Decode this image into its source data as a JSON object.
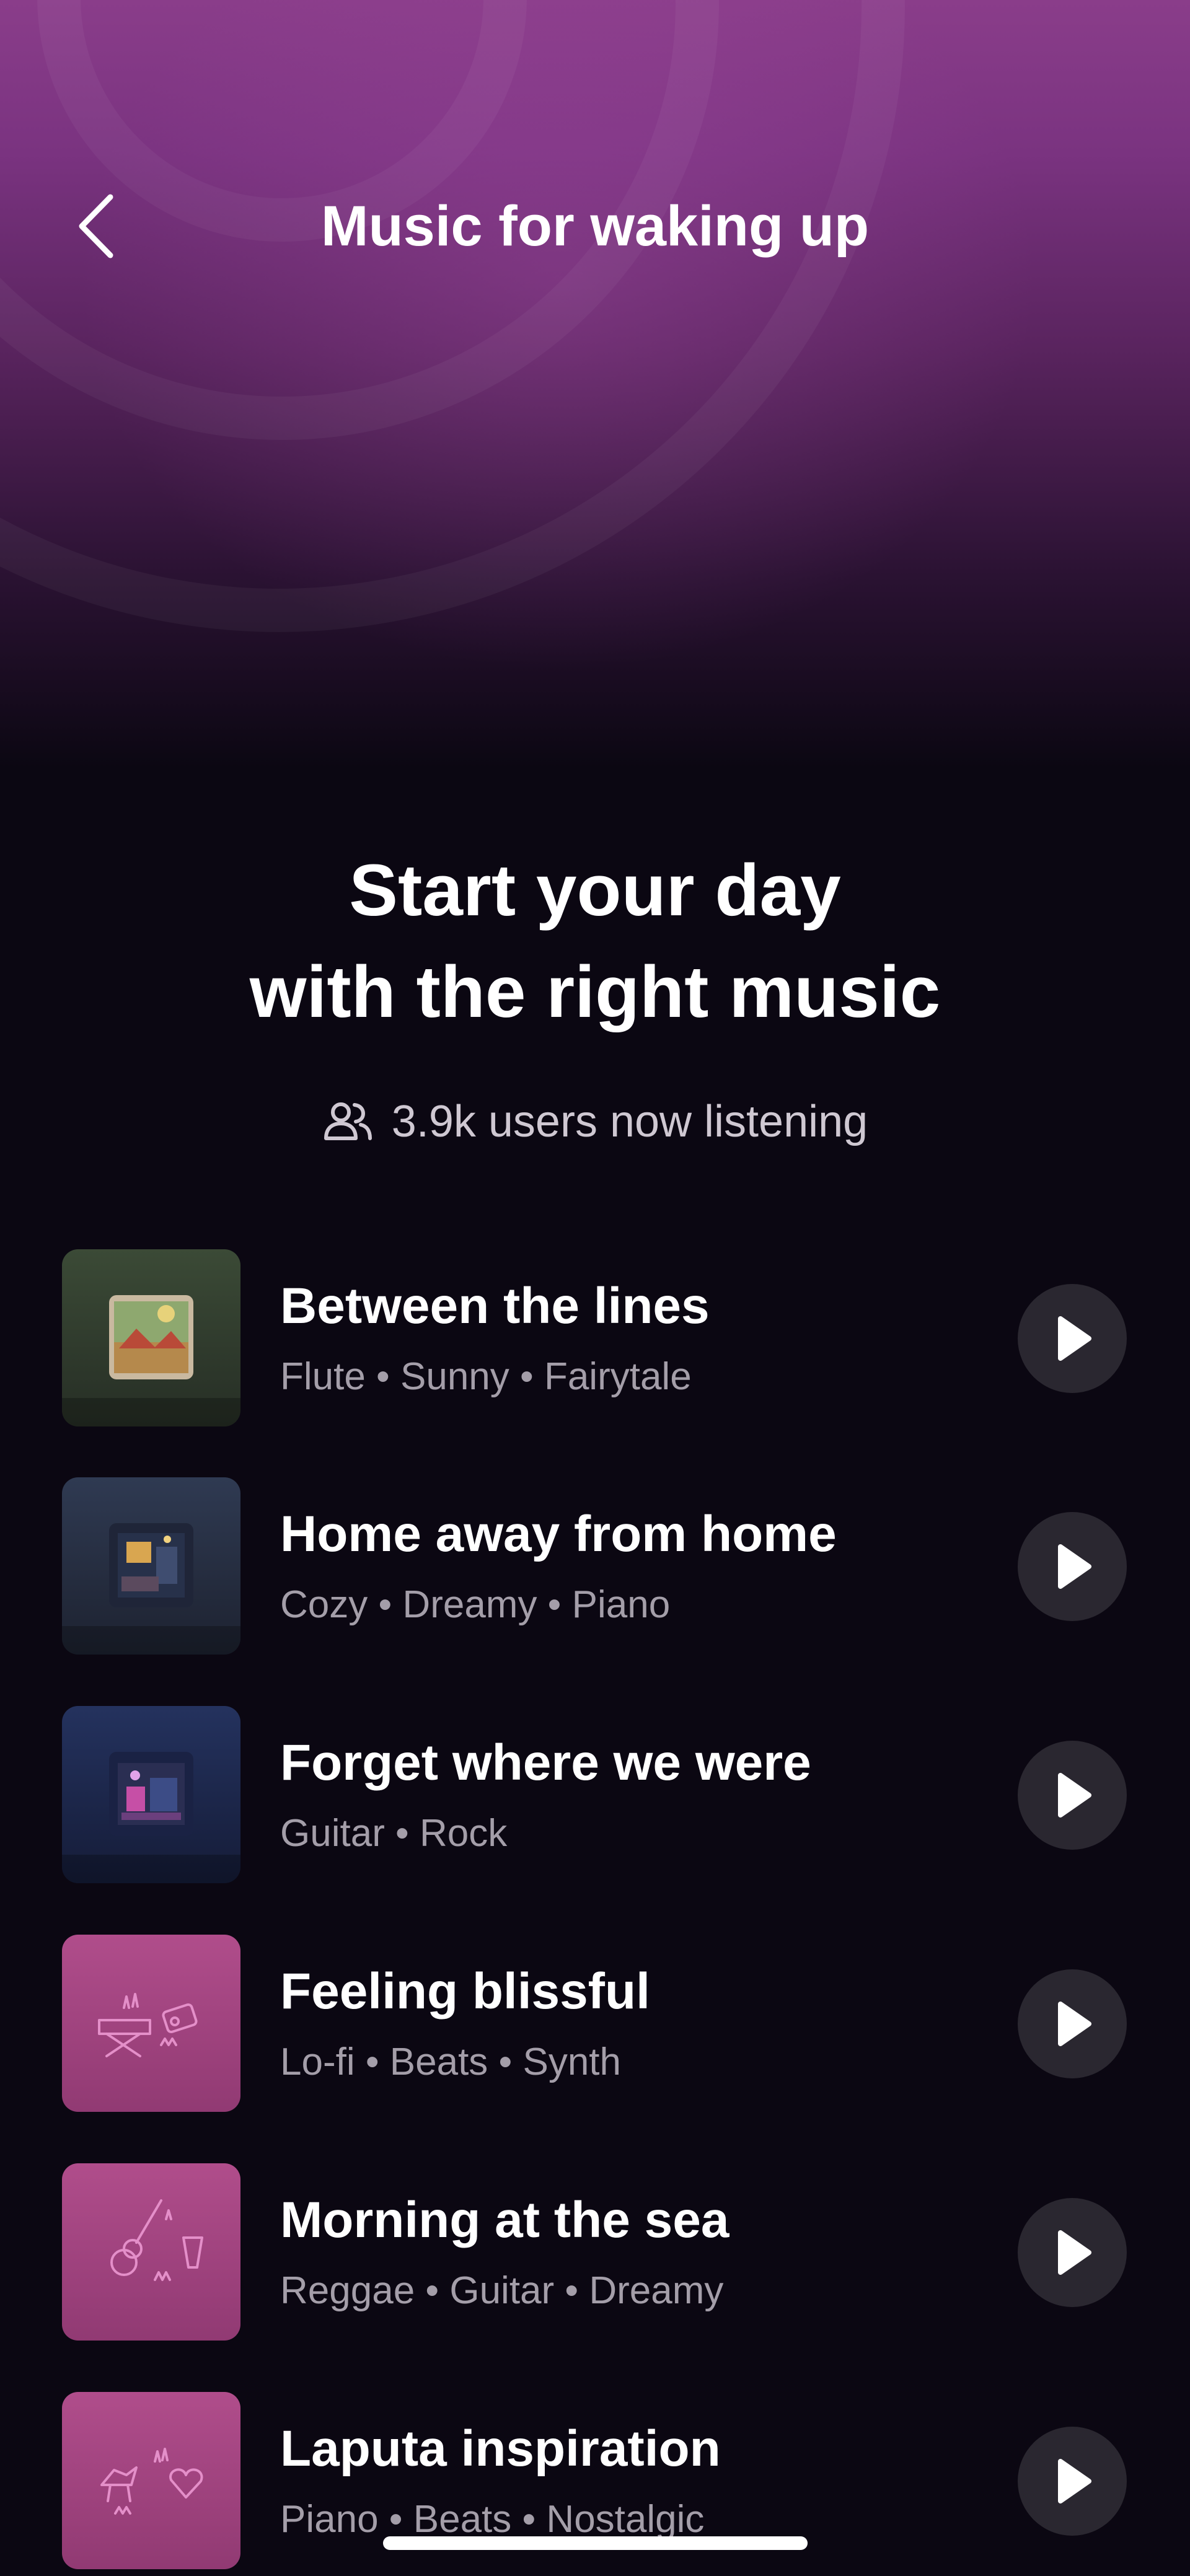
{
  "header": {
    "title": "Music for waking up",
    "back_icon": "chevron-left-icon"
  },
  "hero": {
    "headline_line1": "Start your day",
    "headline_line2": "with the right music",
    "listeners_icon": "users-icon",
    "listeners_text": "3.9k users now listening"
  },
  "colors": {
    "background": "#0b0712",
    "hero_gradient_top": "#8a3d8a",
    "play_button_bg": "#2a2730",
    "secondary_text": "#a49ea9",
    "pink_artwork": "#a4427f"
  },
  "tracks": [
    {
      "title": "Between the lines",
      "tags": "Flute • Sunny • Fairytale",
      "artwork": "green-scenery-artwork"
    },
    {
      "title": "Home away from home",
      "tags": "Cozy • Dreamy • Piano",
      "artwork": "night-room-artwork"
    },
    {
      "title": "Forget where we were",
      "tags": "Guitar • Rock",
      "artwork": "blue-neon-artwork"
    },
    {
      "title": "Feeling blissful",
      "tags": "Lo-fi • Beats • Synth",
      "artwork": "pink-synth-artwork"
    },
    {
      "title": "Morning at the sea",
      "tags": "Reggae • Guitar • Dreamy",
      "artwork": "pink-guitar-artwork"
    },
    {
      "title": "Laputa inspiration",
      "tags": "Piano • Beats • Nostalgic",
      "artwork": "pink-piano-artwork"
    }
  ]
}
